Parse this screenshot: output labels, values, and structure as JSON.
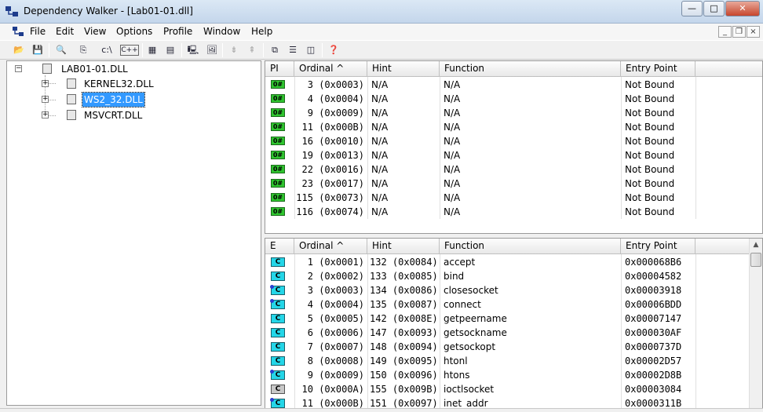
{
  "window": {
    "title": "Dependency Walker - [Lab01-01.dll]",
    "min": "—",
    "max": "□",
    "close": "✕"
  },
  "menu": [
    "File",
    "Edit",
    "View",
    "Options",
    "Profile",
    "Window",
    "Help"
  ],
  "mdi": {
    "min": "_",
    "restore": "❐",
    "close": "×"
  },
  "toolbar": [
    {
      "name": "open-icon",
      "glyph": "📂"
    },
    {
      "name": "save-icon",
      "glyph": "💾"
    },
    {
      "name": "find-icon",
      "glyph": "🔍"
    },
    {
      "name": "copy-icon",
      "glyph": "⎘"
    },
    {
      "name": "full-paths-icon",
      "glyph": "c:\\"
    },
    {
      "name": "undecorate-icon",
      "glyph": "C++"
    },
    {
      "name": "module-list-icon",
      "glyph": "▦"
    },
    {
      "name": "properties-icon",
      "glyph": "▤"
    },
    {
      "name": "system-info-icon",
      "glyph": "🖳"
    },
    {
      "name": "external-viewer-icon",
      "glyph": "🖼"
    },
    {
      "name": "expand-all-icon",
      "glyph": "⇟"
    },
    {
      "name": "collapse-all-icon",
      "glyph": "⇞"
    },
    {
      "name": "cascade-icon",
      "glyph": "⧉"
    },
    {
      "name": "tile-horizontal-icon",
      "glyph": "☰"
    },
    {
      "name": "tile-vertical-icon",
      "glyph": "◫"
    },
    {
      "name": "help-icon",
      "glyph": "❓"
    }
  ],
  "tree": {
    "root": "LAB01-01.DLL",
    "children": [
      "KERNEL32.DLL",
      "WS2_32.DLL",
      "MSVCRT.DLL"
    ],
    "selected": "WS2_32.DLL"
  },
  "imports": {
    "headers": [
      "PI",
      "Ordinal ^",
      "Hint",
      "Function",
      "Entry Point"
    ],
    "badge": "0#",
    "rows": [
      {
        "ordinal": "3 (0x0003)",
        "hint": "N/A",
        "function": "N/A",
        "entry": "Not Bound"
      },
      {
        "ordinal": "4 (0x0004)",
        "hint": "N/A",
        "function": "N/A",
        "entry": "Not Bound"
      },
      {
        "ordinal": "9 (0x0009)",
        "hint": "N/A",
        "function": "N/A",
        "entry": "Not Bound"
      },
      {
        "ordinal": "11 (0x000B)",
        "hint": "N/A",
        "function": "N/A",
        "entry": "Not Bound"
      },
      {
        "ordinal": "16 (0x0010)",
        "hint": "N/A",
        "function": "N/A",
        "entry": "Not Bound"
      },
      {
        "ordinal": "19 (0x0013)",
        "hint": "N/A",
        "function": "N/A",
        "entry": "Not Bound"
      },
      {
        "ordinal": "22 (0x0016)",
        "hint": "N/A",
        "function": "N/A",
        "entry": "Not Bound"
      },
      {
        "ordinal": "23 (0x0017)",
        "hint": "N/A",
        "function": "N/A",
        "entry": "Not Bound"
      },
      {
        "ordinal": "115 (0x0073)",
        "hint": "N/A",
        "function": "N/A",
        "entry": "Not Bound"
      },
      {
        "ordinal": "116 (0x0074)",
        "hint": "N/A",
        "function": "N/A",
        "entry": "Not Bound"
      }
    ]
  },
  "exports": {
    "headers": [
      "E",
      "Ordinal ^",
      "Hint",
      "Function",
      "Entry Point"
    ],
    "badge": "C",
    "rows": [
      {
        "ordinal": "1 (0x0001)",
        "hint": "132 (0x0084)",
        "function": "accept",
        "entry": "0x000068B6",
        "dot": false,
        "gray": false
      },
      {
        "ordinal": "2 (0x0002)",
        "hint": "133 (0x0085)",
        "function": "bind",
        "entry": "0x00004582",
        "dot": false,
        "gray": false
      },
      {
        "ordinal": "3 (0x0003)",
        "hint": "134 (0x0086)",
        "function": "closesocket",
        "entry": "0x00003918",
        "dot": true,
        "gray": false
      },
      {
        "ordinal": "4 (0x0004)",
        "hint": "135 (0x0087)",
        "function": "connect",
        "entry": "0x00006BDD",
        "dot": true,
        "gray": false
      },
      {
        "ordinal": "5 (0x0005)",
        "hint": "142 (0x008E)",
        "function": "getpeername",
        "entry": "0x00007147",
        "dot": false,
        "gray": false
      },
      {
        "ordinal": "6 (0x0006)",
        "hint": "147 (0x0093)",
        "function": "getsockname",
        "entry": "0x000030AF",
        "dot": false,
        "gray": false
      },
      {
        "ordinal": "7 (0x0007)",
        "hint": "148 (0x0094)",
        "function": "getsockopt",
        "entry": "0x0000737D",
        "dot": false,
        "gray": false
      },
      {
        "ordinal": "8 (0x0008)",
        "hint": "149 (0x0095)",
        "function": "htonl",
        "entry": "0x00002D57",
        "dot": false,
        "gray": false
      },
      {
        "ordinal": "9 (0x0009)",
        "hint": "150 (0x0096)",
        "function": "htons",
        "entry": "0x00002D8B",
        "dot": true,
        "gray": false
      },
      {
        "ordinal": "10 (0x000A)",
        "hint": "155 (0x009B)",
        "function": "ioctlsocket",
        "entry": "0x00003084",
        "dot": false,
        "gray": true
      },
      {
        "ordinal": "11 (0x000B)",
        "hint": "151 (0x0097)",
        "function": "inet_addr",
        "entry": "0x0000311B",
        "dot": true,
        "gray": false
      }
    ]
  },
  "colors": {
    "selection": "#3399ff",
    "import_badge": "#2fc52f",
    "export_badge": "#24d6e8"
  }
}
